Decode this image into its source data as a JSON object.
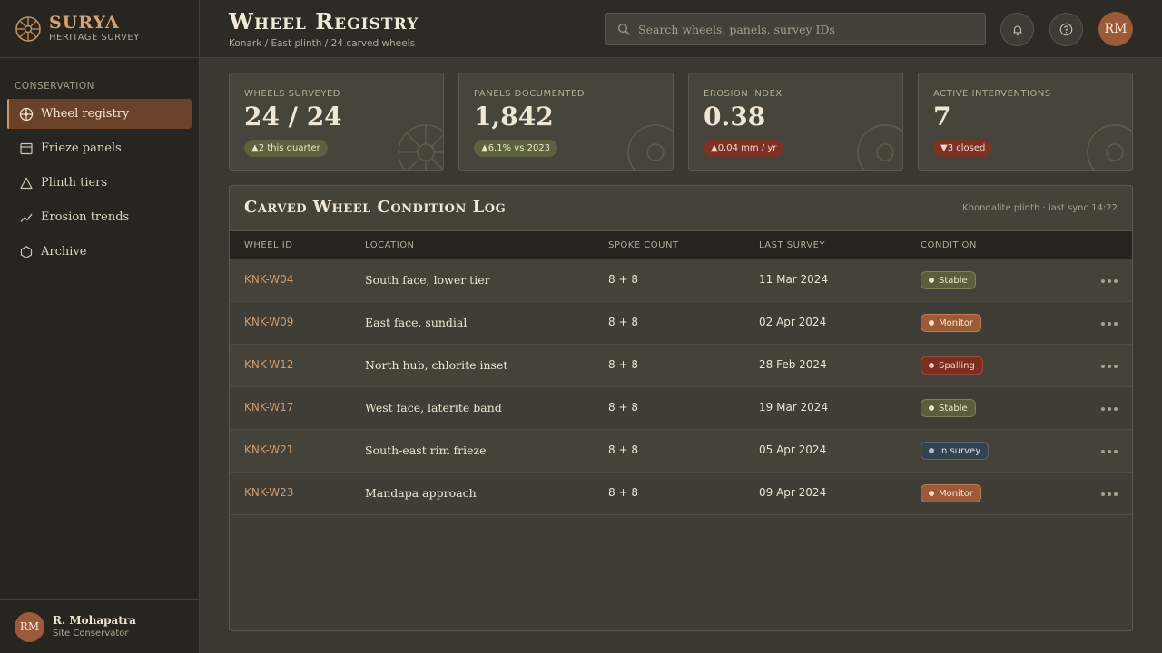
{
  "brand": {
    "name": "SURYA",
    "subtitle": "HERITAGE SURVEY",
    "logo_icon": "wheel-logo-icon"
  },
  "sidebar": {
    "section": "CONSERVATION",
    "items": [
      {
        "label": "Wheel registry",
        "icon": "wheel-icon",
        "active": true
      },
      {
        "label": "Frieze panels",
        "icon": "panel-icon",
        "active": false
      },
      {
        "label": "Plinth tiers",
        "icon": "triangle-icon",
        "active": false
      },
      {
        "label": "Erosion trends",
        "icon": "trend-icon",
        "active": false
      },
      {
        "label": "Archive",
        "icon": "hexagon-icon",
        "active": false
      }
    ],
    "user": {
      "initials": "RM",
      "name": "R. Mohapatra",
      "role": "Site Conservator"
    }
  },
  "header": {
    "title": "Wheel Registry",
    "breadcrumb": "Konark / East plinth / 24 carved wheels",
    "search_placeholder": "Search wheels, panels, survey IDs",
    "avatar_initials": "RM"
  },
  "stats": [
    {
      "label": "WHEELS SURVEYED",
      "value": "24 / 24",
      "delta": "▲2 this quarter",
      "tone": "green"
    },
    {
      "label": "PANELS DOCUMENTED",
      "value": "1,842",
      "delta": "▲6.1% vs 2023",
      "tone": "green"
    },
    {
      "label": "EROSION INDEX",
      "value": "0.38",
      "delta": "▲0.04 mm / yr",
      "tone": "red"
    },
    {
      "label": "ACTIVE INTERVENTIONS",
      "value": "7",
      "delta": "▼3 closed",
      "tone": "red"
    }
  ],
  "log": {
    "title": "Carved Wheel Condition Log",
    "meta": "Khondalite plinth · last sync 14:22",
    "columns": [
      "WHEEL ID",
      "LOCATION",
      "SPOKE COUNT",
      "LAST SURVEY",
      "CONDITION"
    ],
    "rows": [
      {
        "id": "KNK-W04",
        "location": "South face, lower tier",
        "spokes": "8 + 8",
        "date": "11 Mar 2024",
        "condition": "Stable"
      },
      {
        "id": "KNK-W09",
        "location": "East face, sundial",
        "spokes": "8 + 8",
        "date": "02 Apr 2024",
        "condition": "Monitor"
      },
      {
        "id": "KNK-W12",
        "location": "North hub, chlorite inset",
        "spokes": "8 + 8",
        "date": "28 Feb 2024",
        "condition": "Spalling"
      },
      {
        "id": "KNK-W17",
        "location": "West face, laterite band",
        "spokes": "8 + 8",
        "date": "19 Mar 2024",
        "condition": "Stable"
      },
      {
        "id": "KNK-W21",
        "location": "South-east rim frieze",
        "spokes": "8 + 8",
        "date": "05 Apr 2024",
        "condition": "In survey"
      },
      {
        "id": "KNK-W23",
        "location": "Mandapa approach",
        "spokes": "8 + 8",
        "date": "09 Apr 2024",
        "condition": "Monitor"
      }
    ]
  },
  "colors": {
    "accent": "#d6a273",
    "active_nav": "#6a4129",
    "stable": "#5a5e3d",
    "monitor": "#9c5a37",
    "spalling": "#7a2f22",
    "in_survey": "#354350"
  }
}
